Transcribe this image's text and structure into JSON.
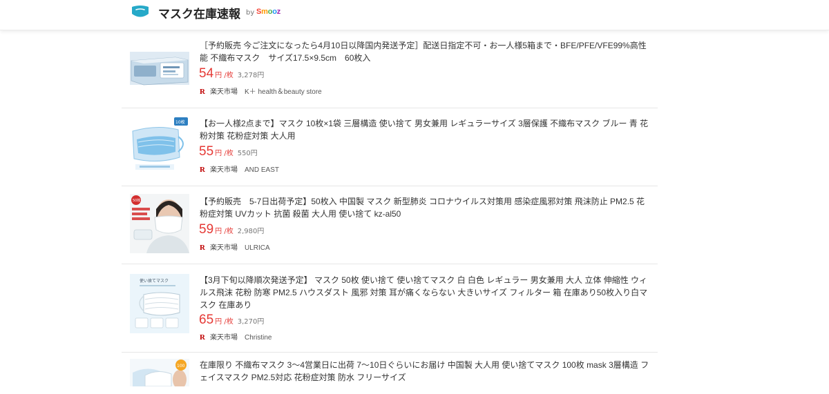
{
  "header": {
    "title": "マスク在庫速報",
    "by": "by",
    "brand": "Smooz",
    "brand_colors": [
      "#f44336",
      "#ff9800",
      "#4caf50",
      "#2196f3",
      "#9c27b0"
    ],
    "logo_icon": "mask-icon",
    "logo_color": "#26a9c8"
  },
  "products": [
    {
      "title": "［予約販売 今ご注文になったら4月10日以降国内発送予定］配送日指定不可・お一人様5箱まで・BFE/PFE/VFE99%高性能 不織布マスク　サイズ17.5×9.5cm　60枚入",
      "price": "54",
      "unit": "円 /枚",
      "total": "3,278円",
      "market": "楽天市場",
      "shop": "K＋ health＆beauty store"
    },
    {
      "title": "【お一人様2点まで】マスク 10枚×1袋 三層構造 使い捨て 男女兼用 レギュラーサイズ 3層保護 不織布マスク ブルー 青 花粉対策 花粉症対策 大人用",
      "price": "55",
      "unit": "円 /枚",
      "total": "550円",
      "market": "楽天市場",
      "shop": "AND EAST",
      "badge": "10枚"
    },
    {
      "title": "【予約販売　5-7日出荷予定】50枚入 中国製 マスク 新型肺炎 コロナウイルス対策用 感染症風邪対策 飛沫防止 PM2.5 花粉症対策 UVカット 抗菌 殺菌 大人用 使い捨て kz-al50",
      "price": "59",
      "unit": "円 /枚",
      "total": "2,980円",
      "market": "楽天市場",
      "shop": "ULRICA",
      "badge": "50枚"
    },
    {
      "title": "【3月下旬以降順次発送予定】 マスク 50枚 使い捨て 使い捨てマスク 白 白色 レギュラー 男女兼用 大人 立体 伸縮性 ウィルス飛沫 花粉 防寒 PM2.5 ハウスダスト 風邪 対策 耳が痛くならない 大きいサイズ フィルター 箱 在庫あり50枚入り白マスク 在庫あり",
      "price": "65",
      "unit": "円 /枚",
      "total": "3,270円",
      "market": "楽天市場",
      "shop": "Christine",
      "image_text": "使い捨てマスク"
    },
    {
      "title": "在庫限り 不織布マスク 3～4営業日に出荷 7～10日ぐらいにお届け 中国製 大人用 使い捨てマスク 100枚 mask 3層構造 フェイスマスク PM2.5対応 花粉症対策 防水 フリーサイズ",
      "badge": "100"
    }
  ],
  "colors": {
    "price": "#e53935",
    "rakuten": "#bf0000",
    "divider": "#e6e6e6"
  }
}
